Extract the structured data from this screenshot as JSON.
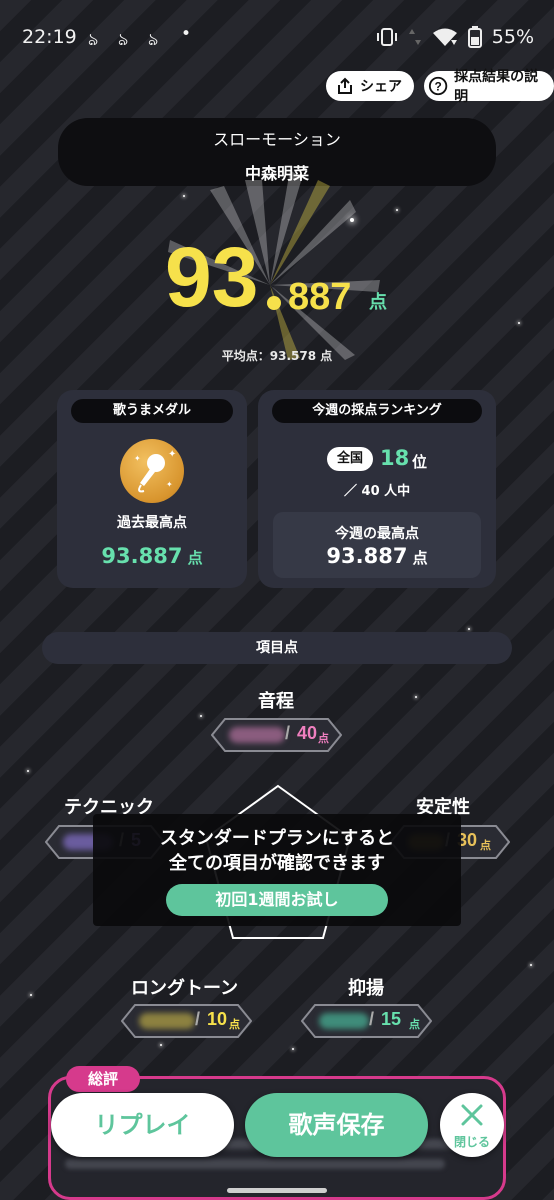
{
  "status_bar": {
    "time": "22:19",
    "notification_icons": [
      "ja-alpha-icon",
      "ja-alpha-icon",
      "ja-alpha-icon",
      "dot"
    ],
    "battery": "55%"
  },
  "header": {
    "share_label": "シェア",
    "explain_label": "採点結果の説明"
  },
  "song": {
    "title": "スローモーション",
    "artist": "中森明菜"
  },
  "score": {
    "integer": "93",
    "decimal": "887",
    "unit": "点",
    "average_label": "平均点：93.578 点"
  },
  "medal_card": {
    "heading": "歌うまメダル",
    "best_label": "過去最高点",
    "best_value": "93.887",
    "unit": "点"
  },
  "ranking_card": {
    "heading": "今週の採点ランキング",
    "scope_badge": "全国",
    "rank": "18",
    "rank_unit": "位",
    "total": "／ 40 人中",
    "weekly_best_label": "今週の最高点",
    "weekly_best_value": "93.887",
    "unit": "点"
  },
  "items": {
    "heading": "項目点",
    "pitch": {
      "label": "音程",
      "max": "40",
      "unit": "点"
    },
    "technique": {
      "label": "テクニック",
      "max": "5",
      "unit": "点"
    },
    "stability": {
      "label": "安定性",
      "max": "30",
      "unit": "点"
    },
    "longtone": {
      "label": "ロングトーン",
      "max": "10",
      "unit": "点"
    },
    "inflection": {
      "label": "抑揚",
      "max": "15",
      "unit": "点"
    },
    "slash": "/"
  },
  "upsell": {
    "line1": "スタンダードプランにすると",
    "line2": "全ての項目が確認できます",
    "button": "初回1週間お試し"
  },
  "summary": {
    "tag": "総評"
  },
  "actions": {
    "replay": "リプレイ",
    "save_voice": "歌声保存",
    "close": "閉じる"
  },
  "colors": {
    "score_yellow": "#f6e14b",
    "mint": "#67e0ad",
    "pink": "#ef7fbf",
    "accent_pink": "#d63a8c",
    "button_green": "#5ec59c",
    "card_bg": "#2d2f3b"
  }
}
